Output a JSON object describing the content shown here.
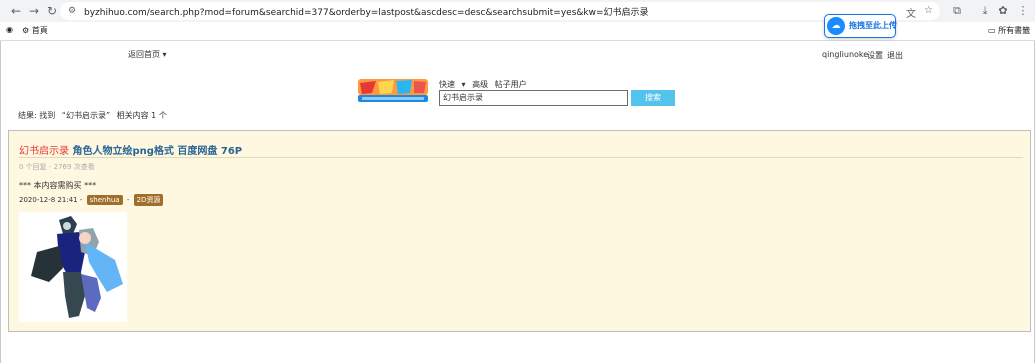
{
  "browser": {
    "url": "byzhihuo.com/search.php?mod=forum&searchid=377&orderby=lastpost&ascdesc=desc&searchsubmit=yes&kw=幻书启示录",
    "bookmarks": [
      "首頁"
    ],
    "all_bookmarks_label": "所有書籤",
    "upload_extension_label": "拖拽至此上传"
  },
  "topnav": {
    "home_label": "返回首页",
    "username": "qingliunoke",
    "settings_label": "设置",
    "logout_label": "退出"
  },
  "search": {
    "tabs": [
      "快速",
      "高级",
      "帖子用户"
    ],
    "query": "幻书启示录",
    "button_label": "搜索"
  },
  "results_summary": {
    "prefix": "结果: 找到",
    "keyword": "“幻书启示录”",
    "suffix": "相关内容 1 个"
  },
  "result": {
    "title_keyword": "幻书启示录",
    "title_rest": "角色人物立绘png格式 百度网盘 76P",
    "stats": "0 个回复 - 2769 次查看",
    "purchase_note": "*** 本内容需购买 ***",
    "date": "2020-12-8 21:41",
    "author": "shenhua",
    "category": "2D资源"
  },
  "colors": {
    "result_bg": "#fff8e1",
    "title_link": "#2a6496",
    "keyword": "#e53935",
    "search_button": "#54c3eb",
    "tag": "#a0702a"
  }
}
